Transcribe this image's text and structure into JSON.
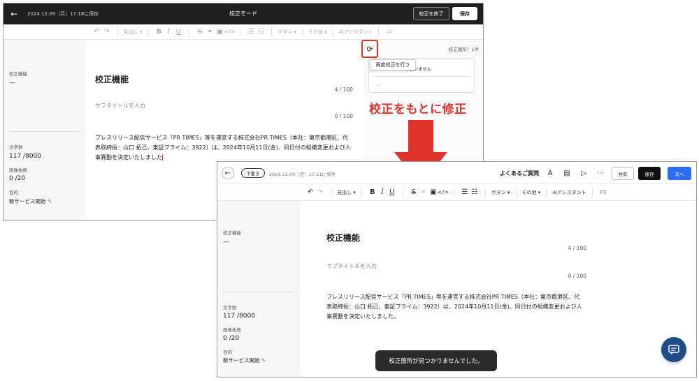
{
  "top": {
    "saved_text": "2024.12.09（月）17:18に保存",
    "mode_title": "校正モード",
    "end_button": "校正を終了",
    "save_button": "保存",
    "toolbar": {
      "heading": "見出し",
      "button": "ボタン",
      "other": "その他",
      "ai": "AIアシスタント"
    },
    "sidebar": {
      "proof_label": "校正機能",
      "proof_value": "—",
      "char_label": "文字数",
      "char_value": "117 /8000",
      "image_label": "画像枚数",
      "image_value": "0 /20",
      "purpose_label": "目的",
      "purpose_value": "新サービス開始"
    },
    "editor": {
      "title": "校正機能",
      "title_count": "4 / 100",
      "subtitle_placeholder": "サブタイトルを入力",
      "subtitle_count": "0 / 100",
      "body_lines": [
        "プレスリリース配信サービス「PR TIMES」等を運営する株式会社PR TIMES（本社：東京都港区、代",
        "表取締役：山口 拓己、東証プライム：3922）は、2024年10月11日(金)、同日付の組織変更および人",
        "事異動を決定いたしました"
      ]
    },
    "proof_panel": {
      "count": "校正箇所：1件",
      "message_partial": "ドは使いません",
      "dots": "…ᐧ",
      "tooltip": "再度校正を行う"
    }
  },
  "annotation": {
    "label": "校正をもとに修正",
    "color": "#e0332a"
  },
  "bottom": {
    "draft_badge": "下書き",
    "saved_text": "2024.12.09（月）17:21に保存",
    "faq": "よくあるご質問",
    "share_button": "共有",
    "save_button": "保存",
    "next_button": "次へ",
    "toolbar": {
      "heading": "見出し",
      "button": "ボタン",
      "other": "その他",
      "ai": "AIアシスタント"
    },
    "sidebar": {
      "proof_label": "校正機能",
      "proof_value": "—",
      "char_label": "文字数",
      "char_value": "117 /8000",
      "image_label": "画像枚数",
      "image_value": "0 /20",
      "purpose_label": "目的",
      "purpose_value": "新サービス開始"
    },
    "editor": {
      "title": "校正機能",
      "title_count": "4 / 100",
      "subtitle_placeholder": "サブタイトルを入力",
      "subtitle_count": "0 / 100",
      "body_lines": [
        "プレスリリース配信サービス「PR TIMES」等を運営する株式会社PR TIMES（本社：東京都港区、代",
        "表取締役：山口 拓己、東証プライム：3922）は、2024年10月11日(金)、同日付の組織変更および人",
        "事異動を決定いたしました。"
      ]
    },
    "toast": "校正箇所が見つかりませんでした。"
  }
}
